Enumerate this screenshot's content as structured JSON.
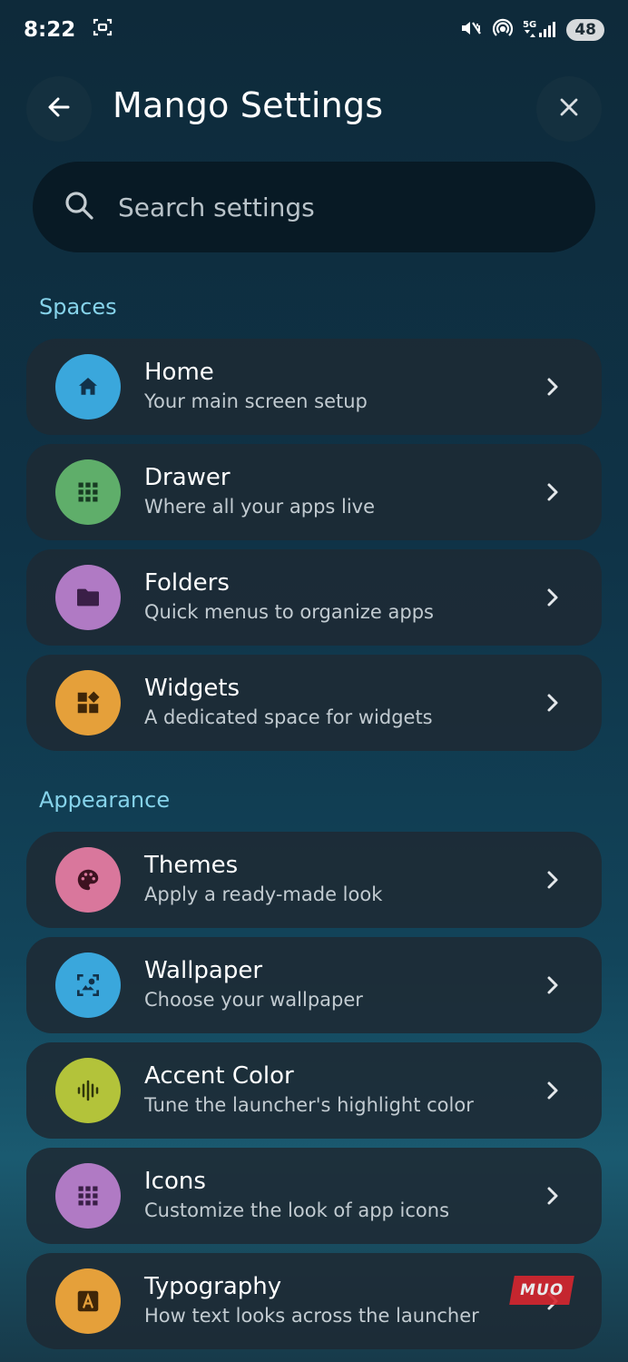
{
  "status": {
    "time": "8:22",
    "battery": "48",
    "network": "5G"
  },
  "header": {
    "title": "Mango Settings"
  },
  "search": {
    "placeholder": "Search settings"
  },
  "sections": [
    {
      "label": "Spaces",
      "items": [
        {
          "title": "Home",
          "subtitle": "Your main screen setup",
          "icon": "home-icon",
          "color": "#3aa7dc"
        },
        {
          "title": "Drawer",
          "subtitle": "Where all your apps live",
          "icon": "grid-icon",
          "color": "#5fae6a"
        },
        {
          "title": "Folders",
          "subtitle": "Quick menus to organize apps",
          "icon": "folder-icon",
          "color": "#b07ac4"
        },
        {
          "title": "Widgets",
          "subtitle": "A dedicated space for widgets",
          "icon": "widgets-icon",
          "color": "#e5a03a"
        }
      ]
    },
    {
      "label": "Appearance",
      "items": [
        {
          "title": "Themes",
          "subtitle": "Apply a ready-made look",
          "icon": "palette-icon",
          "color": "#d9779c"
        },
        {
          "title": "Wallpaper",
          "subtitle": "Choose your wallpaper",
          "icon": "wallpaper-icon",
          "color": "#3aa7dc"
        },
        {
          "title": "Accent Color",
          "subtitle": "Tune the launcher's highlight color",
          "icon": "waveform-icon",
          "color": "#b3c33a"
        },
        {
          "title": "Icons",
          "subtitle": "Customize the look of app icons",
          "icon": "grid-icon",
          "color": "#b07ac4"
        },
        {
          "title": "Typography",
          "subtitle": "How text looks across the launcher",
          "icon": "font-icon",
          "color": "#e5a03a"
        }
      ]
    }
  ],
  "watermark": "MUO"
}
